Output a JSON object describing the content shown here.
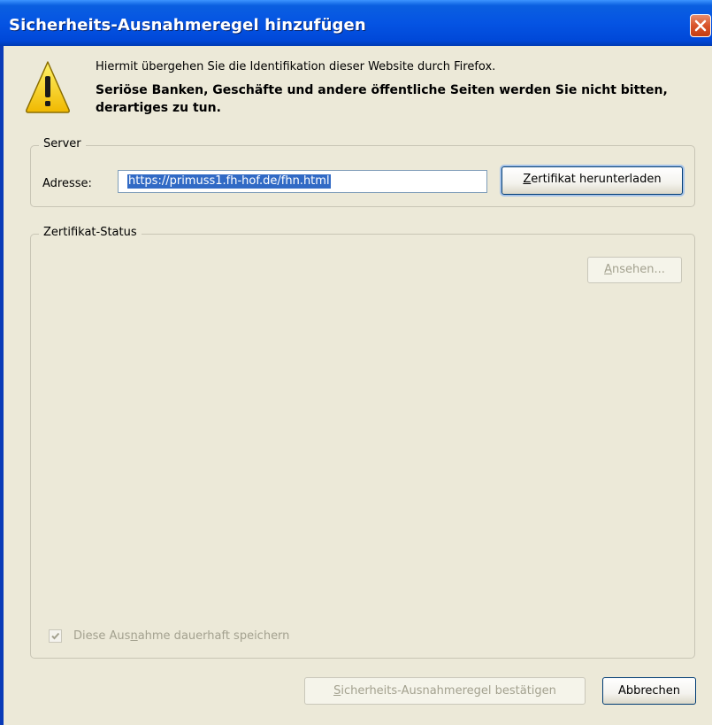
{
  "window": {
    "title": "Sicherheits-Ausnahmeregel hinzufügen",
    "close_icon": "close-icon"
  },
  "message": {
    "icon": "warning-icon",
    "line1": "Hiermit übergehen Sie die Identifikation dieser Website durch Firefox.",
    "line2": "Seriöse Banken, Geschäfte und andere öffentliche Seiten werden Sie nicht bitten, derartiges zu tun."
  },
  "server": {
    "group_label": "Server",
    "address_label": "Adresse:",
    "address_value": "https://primuss1.fh-hof.de/fhn.html",
    "download_button": {
      "accesskey": "Z",
      "rest": "ertifikat herunterladen"
    }
  },
  "status": {
    "group_label": "Zertifikat-Status",
    "view_button": {
      "accesskey": "A",
      "rest": "nsehen..."
    },
    "permanent_checkbox": {
      "pre": "Diese Aus",
      "accesskey": "n",
      "post": "ahme dauerhaft speichern",
      "checked": true,
      "disabled": true
    }
  },
  "footer": {
    "confirm_button": {
      "accesskey": "S",
      "rest": "icherheits-Ausnahmeregel bestätigen",
      "disabled": true
    },
    "cancel_button": "Abbrechen"
  },
  "colors": {
    "titlebar": "#0554e3",
    "dialog_bg": "#ece9d8",
    "selection": "#316ac5"
  }
}
